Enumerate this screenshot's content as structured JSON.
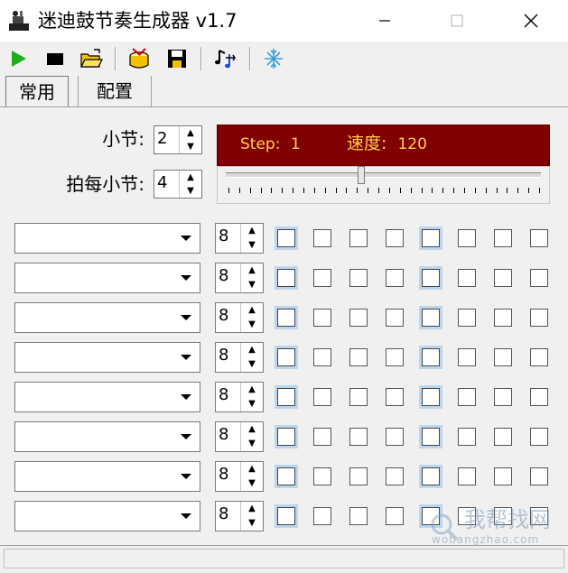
{
  "window": {
    "title": "迷迪鼓节奏生成器 v1.7",
    "minimize_icon": "minimize-icon",
    "maximize_icon": "maximize-icon",
    "close_icon": "close-icon"
  },
  "toolbar": {
    "items": [
      "play-icon",
      "stop-icon",
      "open-folder-icon",
      "drum-icon",
      "save-icon",
      "music-notes-icon",
      "snowflake-icon"
    ]
  },
  "tabs": [
    {
      "label": "常用",
      "active": true
    },
    {
      "label": "配置",
      "active": false
    }
  ],
  "settings": {
    "bars_label": "小节:",
    "bars_value": "2",
    "beats_label": "拍每小节:",
    "beats_value": "4"
  },
  "status": {
    "step_label": "Step:",
    "step_value": "1",
    "speed_label": "速度:",
    "speed_value": "120",
    "slider_fraction": 0.43,
    "panel_color": "#800000",
    "text_color": "#ffd24a"
  },
  "rows": [
    {
      "instrument": "",
      "value": "8"
    },
    {
      "instrument": "",
      "value": "8"
    },
    {
      "instrument": "",
      "value": "8"
    },
    {
      "instrument": "",
      "value": "8"
    },
    {
      "instrument": "",
      "value": "8"
    },
    {
      "instrument": "",
      "value": "8"
    },
    {
      "instrument": "",
      "value": "8"
    },
    {
      "instrument": "",
      "value": "8"
    }
  ],
  "grid": {
    "steps_per_row": 8,
    "highlighted_steps": [
      0,
      4
    ]
  },
  "watermark": {
    "text": "我帮找网",
    "url_text": "wobangzhao.com"
  },
  "statusbar": {
    "text": ""
  }
}
